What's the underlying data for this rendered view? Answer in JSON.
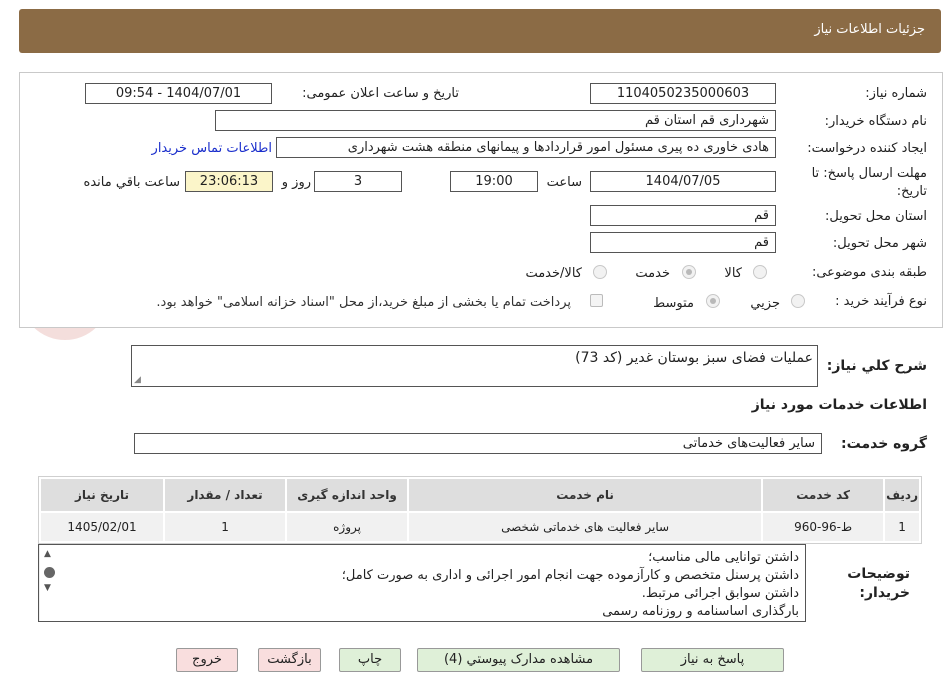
{
  "header": {
    "title": "جزئیات اطلاعات نیاز"
  },
  "form": {
    "need_number_label": "شماره نیاز:",
    "need_number": "1104050235000603",
    "announce_label": "تاریخ و ساعت اعلان عمومی:",
    "announce_value": "1404/07/01 - 09:54",
    "buyer_org_label": "نام دستگاه خریدار:",
    "buyer_org": "شهرداری قم استان قم",
    "requester_label": "ایجاد کننده درخواست:",
    "requester": "هادی خاوری ده پیری مسئول امور قراردادها و پیمانهای منطقه هشت شهرداری",
    "contact_link": "اطلاعات تماس خریدار",
    "deadline_label_1": "مهلت ارسال پاسخ: تا",
    "deadline_label_2": "تاریخ:",
    "deadline_date": "1404/07/05",
    "time_label": "ساعت",
    "deadline_time": "19:00",
    "days": "3",
    "days_label": "روز و",
    "remaining_time": "23:06:13",
    "remaining_label": "ساعت باقي مانده",
    "delivery_province_label": "استان محل تحویل:",
    "delivery_province": "قم",
    "delivery_city_label": "شهر محل تحویل:",
    "delivery_city": "قم",
    "category_label": "طبقه بندی موضوعی:",
    "category_options": [
      "کالا",
      "خدمت",
      "کالا/خدمت"
    ],
    "process_label": "نوع فرآیند خرید :",
    "process_options": [
      "جزیي",
      "متوسط"
    ],
    "payment_note": "پرداخت تمام یا بخشی از مبلغ خرید،از محل \"اسناد خزانه اسلامی\" خواهد بود."
  },
  "summary": {
    "label": "شرح کلي نیاز:",
    "value": "عملیات فضای سبز بوستان غدیر (کد 73)"
  },
  "services": {
    "section_title": "اطلاعات خدمات مورد نیاز",
    "group_label": "گروه خدمت:",
    "group_value": "سایر فعالیت‌های خدماتی",
    "columns": [
      "ردیف",
      "کد خدمت",
      "نام خدمت",
      "واحد اندازه گیری",
      "تعداد / مقدار",
      "تاریخ نیاز"
    ],
    "rows": [
      [
        "1",
        "ط-96-960",
        "سایر فعالیت های خدماتی شخصی",
        "پروژه",
        "1",
        "1405/02/01"
      ]
    ]
  },
  "notes": {
    "label_1": "توضیحات",
    "label_2": "خریدار:",
    "lines": [
      "داشتن توانایی مالی مناسب؛",
      "داشتن پرسنل متخصص و کارآزموده جهت انجام امور اجرائی و اداری به صورت کامل؛",
      "داشتن سوابق اجرائی مرتبط.",
      "بارگذاری اساسنامه و روزنامه رسمی"
    ]
  },
  "buttons": {
    "reply": "پاسخ به نیاز",
    "attachments": "مشاهده مدارک پیوستي (4)",
    "print": "چاپ",
    "back": "بازگشت",
    "exit": "خروج"
  },
  "watermark": {
    "text": "AriaTender.neT"
  },
  "colors": {
    "header": "#8b6b45",
    "accent_link": "#1a2ecc",
    "remaining_bg": "#fbf5c9"
  }
}
